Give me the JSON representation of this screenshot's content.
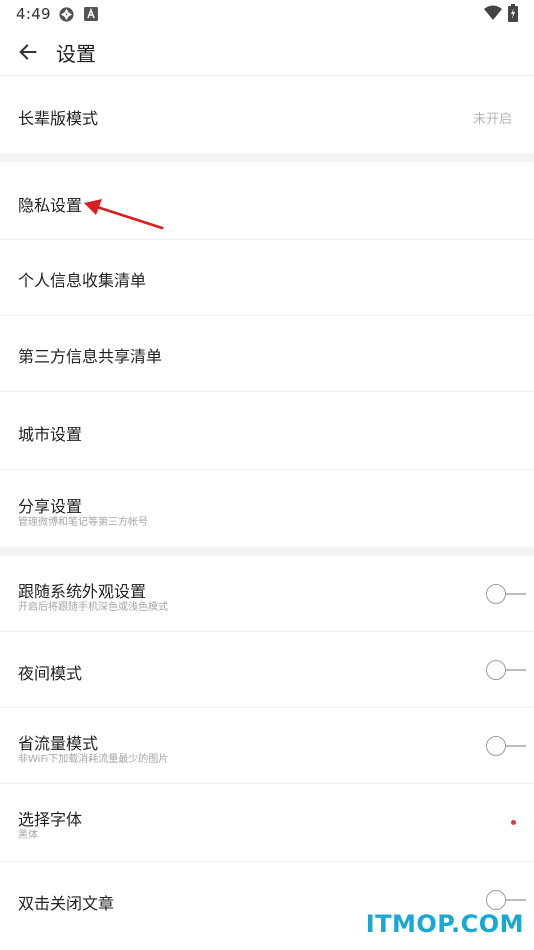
{
  "status_bar": {
    "time": "4:49",
    "icons_left": [
      "aperture-icon",
      "font-a-icon"
    ],
    "icons_right": [
      "wifi-icon",
      "battery-charging-icon"
    ]
  },
  "app_bar": {
    "back_icon": "arrow-left-icon",
    "title": "设置"
  },
  "settings": {
    "elder_mode": {
      "label": "长辈版模式",
      "value": "未开启"
    },
    "privacy": {
      "label": "隐私设置"
    },
    "personal_info_list": {
      "label": "个人信息收集清单"
    },
    "third_party_list": {
      "label": "第三方信息共享清单"
    },
    "city": {
      "label": "城市设置"
    },
    "share": {
      "label": "分享设置",
      "sub": "管理微博和笔记等第三方帐号"
    },
    "follow_system": {
      "label": "跟随系统外观设置",
      "sub": "开启后将跟随手机深色或浅色模式",
      "enabled": false
    },
    "night_mode": {
      "label": "夜间模式",
      "enabled": false
    },
    "data_saver": {
      "label": "省流量模式",
      "sub": "非WiFi下加载消耗流量最少的图片",
      "enabled": false
    },
    "font": {
      "label": "选择字体",
      "sub": "黑体",
      "badge_color": "#e53935"
    },
    "double_tap_close": {
      "label": "双击关闭文章",
      "enabled": false
    }
  },
  "annotation": {
    "arrow_color": "#d81e1e"
  },
  "watermark": {
    "text": "ITMOP.COM",
    "color": "#17a8d6"
  }
}
